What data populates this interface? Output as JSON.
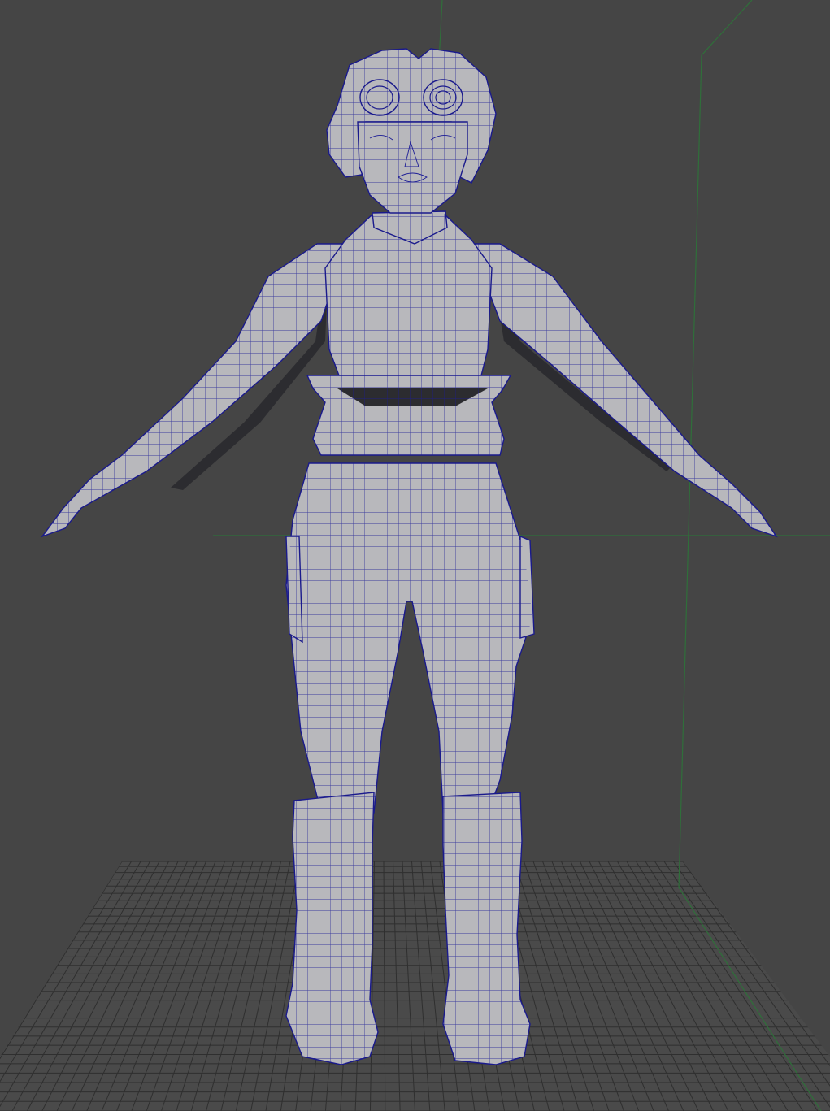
{
  "viewport": {
    "title": "",
    "background_color": "#454545",
    "grid_color": "#2f2f2f",
    "axis_color": "#2f6f3a",
    "wireframe_color": "#1c1c96",
    "mesh_color": "#b8b8bc"
  },
  "model": {
    "icon": "character-mesh-icon"
  }
}
